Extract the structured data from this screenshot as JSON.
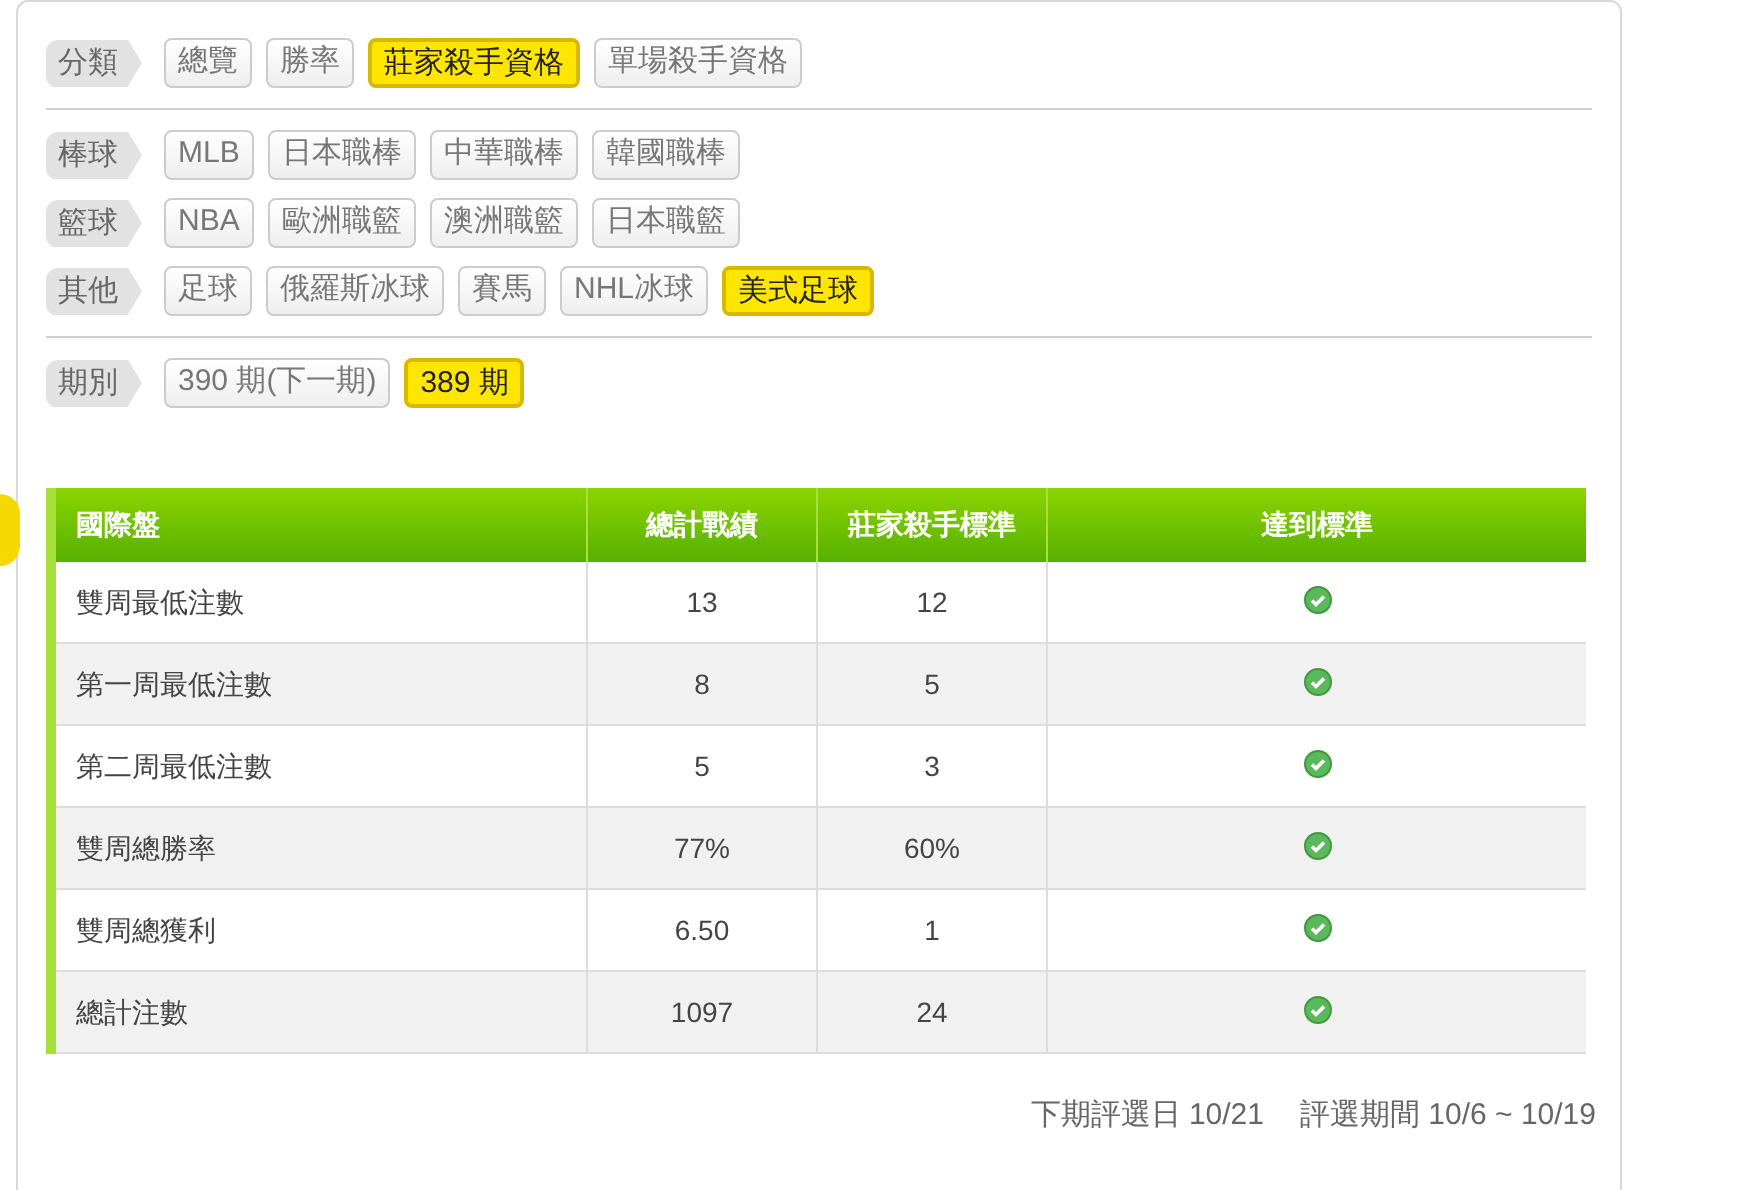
{
  "filter_sections": [
    {
      "groups": [
        {
          "label": "分類",
          "options": [
            {
              "text": "總覽",
              "selected": false
            },
            {
              "text": "勝率",
              "selected": false
            },
            {
              "text": "莊家殺手資格",
              "selected": true
            },
            {
              "text": "單場殺手資格",
              "selected": false
            }
          ]
        }
      ]
    },
    {
      "groups": [
        {
          "label": "棒球",
          "options": [
            {
              "text": "MLB",
              "selected": false
            },
            {
              "text": "日本職棒",
              "selected": false
            },
            {
              "text": "中華職棒",
              "selected": false
            },
            {
              "text": "韓國職棒",
              "selected": false
            }
          ]
        },
        {
          "label": "籃球",
          "options": [
            {
              "text": "NBA",
              "selected": false
            },
            {
              "text": "歐洲職籃",
              "selected": false
            },
            {
              "text": "澳洲職籃",
              "selected": false
            },
            {
              "text": "日本職籃",
              "selected": false
            }
          ]
        },
        {
          "label": "其他",
          "options": [
            {
              "text": "足球",
              "selected": false
            },
            {
              "text": "俄羅斯冰球",
              "selected": false
            },
            {
              "text": "賽馬",
              "selected": false
            },
            {
              "text": "NHL冰球",
              "selected": false
            },
            {
              "text": "美式足球",
              "selected": true
            }
          ]
        }
      ]
    },
    {
      "groups": [
        {
          "label": "期別",
          "options": [
            {
              "text": "390 期(下一期)",
              "selected": false
            },
            {
              "text": "389 期",
              "selected": true
            }
          ]
        }
      ]
    }
  ],
  "table": {
    "columns": [
      "國際盤",
      "總計戰績",
      "莊家殺手標準",
      "達到標準"
    ],
    "rows": [
      {
        "name": "雙周最低注數",
        "total": "13",
        "standard": "12",
        "met": true
      },
      {
        "name": "第一周最低注數",
        "total": "8",
        "standard": "5",
        "met": true
      },
      {
        "name": "第二周最低注數",
        "total": "5",
        "standard": "3",
        "met": true
      },
      {
        "name": "雙周總勝率",
        "total": "77%",
        "standard": "60%",
        "met": true
      },
      {
        "name": "雙周總獲利",
        "total": "6.50",
        "standard": "1",
        "met": true
      },
      {
        "name": "總計注數",
        "total": "1097",
        "standard": "24",
        "met": true
      }
    ]
  },
  "footer": {
    "next_date": "下期評選日 10/21",
    "period": "評選期間 10/6 ~ 10/19"
  }
}
